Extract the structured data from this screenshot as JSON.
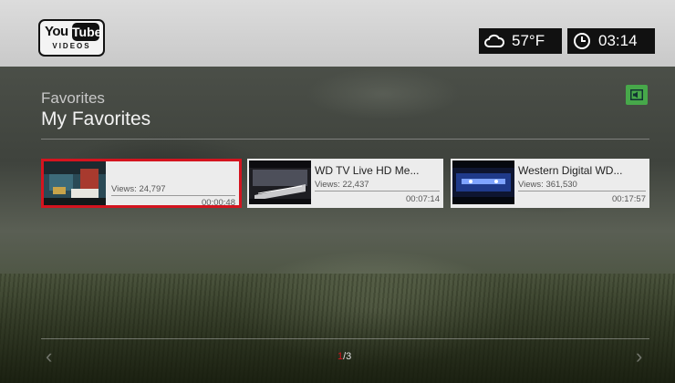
{
  "header": {
    "logo": {
      "word1": "You",
      "word2": "Tube",
      "sub": "VIDEOS"
    },
    "weather": {
      "icon": "cloud-icon",
      "temp": "57°F"
    },
    "clock": {
      "icon": "clock-icon",
      "time": "03:14"
    }
  },
  "breadcrumb": "Favorites",
  "title": "My Favorites",
  "corner_button": {
    "icon": "audio-icon",
    "color": "#47a84a"
  },
  "videos": [
    {
      "title": "",
      "views": "Views: 24,797",
      "duration": "00:00:48",
      "selected": true
    },
    {
      "title": "WD TV Live HD Me...",
      "views": "Views: 22,437",
      "duration": "00:07:14",
      "selected": false
    },
    {
      "title": "Western Digital WD...",
      "views": "Views: 361,530",
      "duration": "00:17:57",
      "selected": false
    }
  ],
  "pagination": {
    "current": "1",
    "total": "/3"
  },
  "nav": {
    "prev": "‹",
    "next": "›"
  },
  "colors": {
    "selection": "#d4141f",
    "accent": "#47a84a"
  }
}
